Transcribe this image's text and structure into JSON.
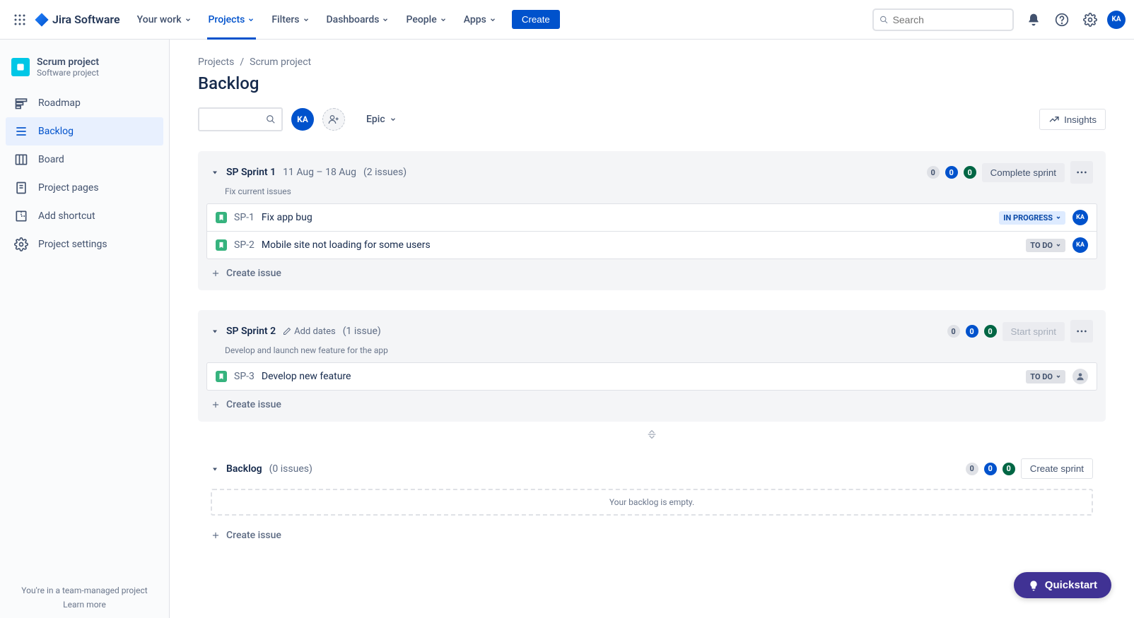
{
  "topnav": {
    "logo_text": "Jira Software",
    "items": [
      {
        "label": "Your work"
      },
      {
        "label": "Projects"
      },
      {
        "label": "Filters"
      },
      {
        "label": "Dashboards"
      },
      {
        "label": "People"
      },
      {
        "label": "Apps"
      }
    ],
    "create_label": "Create",
    "search_placeholder": "Search",
    "avatar_initials": "KA"
  },
  "sidebar": {
    "project_name": "Scrum project",
    "project_type": "Software project",
    "items": [
      {
        "label": "Roadmap"
      },
      {
        "label": "Backlog"
      },
      {
        "label": "Board"
      },
      {
        "label": "Project pages"
      },
      {
        "label": "Add shortcut"
      },
      {
        "label": "Project settings"
      }
    ],
    "footer_text": "You're in a team-managed project",
    "footer_link": "Learn more"
  },
  "breadcrumbs": {
    "root": "Projects",
    "current": "Scrum project"
  },
  "page": {
    "title": "Backlog",
    "epic_label": "Epic",
    "insights_label": "Insights",
    "avatar_initials": "KA"
  },
  "sprints": [
    {
      "name": "SP Sprint 1",
      "dates": "11 Aug – 18 Aug",
      "count_text": "(2 issues)",
      "goal": "Fix current issues",
      "counts": {
        "grey": "0",
        "blue": "0",
        "green": "0"
      },
      "action_label": "Complete sprint",
      "action_disabled": false,
      "has_dates": true,
      "add_dates_label": "Add dates",
      "issues": [
        {
          "key": "SP-1",
          "summary": "Fix app bug",
          "status": "IN PROGRESS",
          "status_class": "inprogress",
          "assignee": "KA"
        },
        {
          "key": "SP-2",
          "summary": "Mobile site not loading for some users",
          "status": "TO DO",
          "status_class": "todo",
          "assignee": "KA"
        }
      ],
      "create_issue_label": "Create issue"
    },
    {
      "name": "SP Sprint 2",
      "dates": "",
      "count_text": "(1 issue)",
      "goal": "Develop and launch new feature for the app",
      "counts": {
        "grey": "0",
        "blue": "0",
        "green": "0"
      },
      "action_label": "Start sprint",
      "action_disabled": true,
      "has_dates": false,
      "add_dates_label": "Add dates",
      "issues": [
        {
          "key": "SP-3",
          "summary": "Develop new feature",
          "status": "TO DO",
          "status_class": "todo",
          "assignee": null
        }
      ],
      "create_issue_label": "Create issue"
    }
  ],
  "backlog": {
    "title": "Backlog",
    "count_text": "(0 issues)",
    "counts": {
      "grey": "0",
      "blue": "0",
      "green": "0"
    },
    "action_label": "Create sprint",
    "empty_text": "Your backlog is empty.",
    "create_issue_label": "Create issue"
  },
  "quickstart_label": "Quickstart"
}
